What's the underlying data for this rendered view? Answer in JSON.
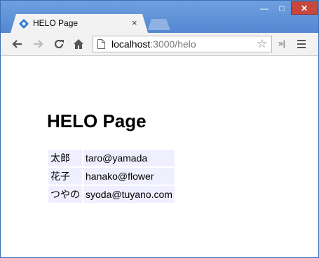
{
  "window": {
    "controls": {
      "minimize": "—",
      "maximize": "□",
      "close": "✕"
    }
  },
  "tab": {
    "title": "HELO Page",
    "close_glyph": "×"
  },
  "toolbar": {
    "url_host": "localhost",
    "url_path": ":3000/helo",
    "ext_glyph": "»|"
  },
  "page": {
    "heading": "HELO Page",
    "rows": [
      {
        "name": "太郎",
        "email": "taro@yamada"
      },
      {
        "name": "花子",
        "email": "hanako@flower"
      },
      {
        "name": "つやの",
        "email": "syoda@tuyano.com"
      }
    ]
  },
  "colors": {
    "frame": "#5b8ed4",
    "cell_bg": "#efefff",
    "close_btn": "#c7473d"
  },
  "icons": [
    "back-icon",
    "forward-icon",
    "reload-icon",
    "home-icon",
    "page-icon",
    "star-icon",
    "menu-icon",
    "favicon-icon"
  ]
}
